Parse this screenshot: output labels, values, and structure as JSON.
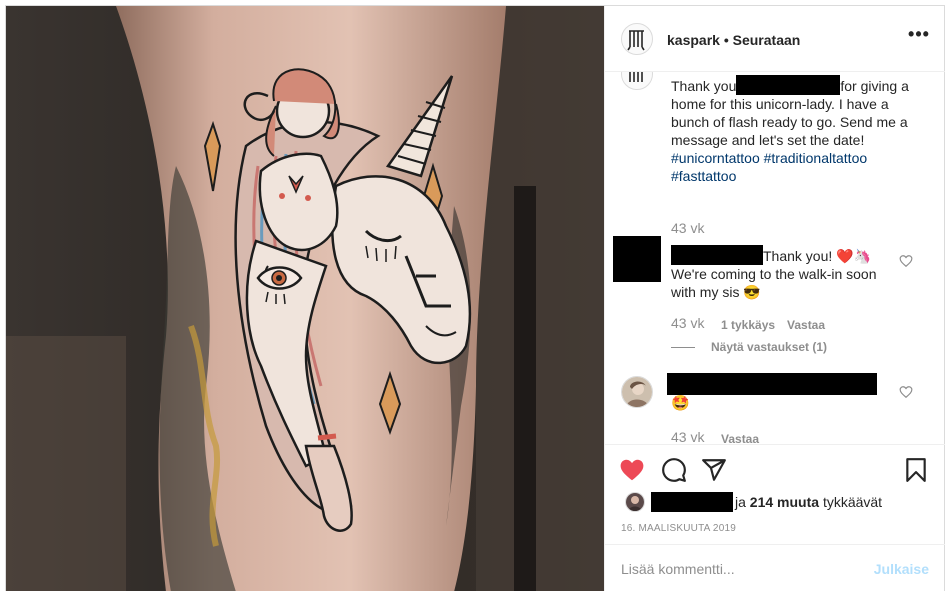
{
  "post": {
    "author": "kaspark",
    "separator": "•",
    "follow_label": "Seurataan",
    "more_icon": "more-options-icon",
    "caption": {
      "part1": "Thank you",
      "part2": "for giving a home for this unicorn-lady. I have a bunch of flash ready to go. Send me a message and let's set the date!",
      "hashtag1": "#unicorntattoo",
      "hashtag2": "#traditionaltattoo",
      "hashtag3": "#fasttattoo",
      "time": "43 vk"
    },
    "comments": [
      {
        "text_line1": "Thank you! ❤️🦄",
        "text_line2": "We're coming to the walk-in soon with my sis 😎",
        "time": "43 vk",
        "likes": "1 tykkäys",
        "reply_label": "Vastaa",
        "view_replies": "Näytä vastaukset (1)"
      },
      {
        "text": "🤩",
        "time": "43 vk",
        "reply_label": "Vastaa"
      }
    ],
    "likes": {
      "and_label": "ja",
      "count_label": "214 muuta",
      "suffix": "tykkäävät"
    },
    "date": "16. MAALISKUUTA 2019",
    "add_comment": {
      "placeholder": "Lisää kommentti...",
      "post_label": "Julkaise"
    }
  },
  "colors": {
    "like_red": "#ed4956",
    "hashtag_blue": "#00376b",
    "post_button_disabled": "#b2dffc",
    "secondary_text": "#8e8e8e"
  }
}
